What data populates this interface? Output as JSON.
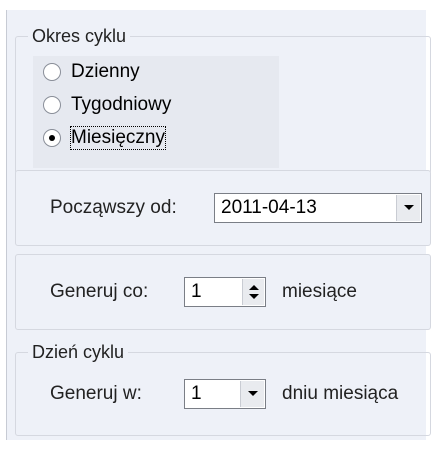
{
  "cycle_period": {
    "legend": "Okres cyklu",
    "options": [
      {
        "label": "Dzienny",
        "checked": false
      },
      {
        "label": "Tygodniowy",
        "checked": false
      },
      {
        "label": "Miesięczny",
        "checked": true
      }
    ]
  },
  "start": {
    "label": "Począwszy od:",
    "value": "2011-04-13"
  },
  "generate_every": {
    "label": "Generuj co:",
    "value": "1",
    "unit": "miesiące"
  },
  "cycle_day": {
    "legend": "Dzień cyklu",
    "label": "Generuj w:",
    "value": "1",
    "unit": "dniu miesiąca"
  },
  "icons": {
    "dropdown": "chevron-down-icon",
    "spin": "spin-updown-icon"
  }
}
